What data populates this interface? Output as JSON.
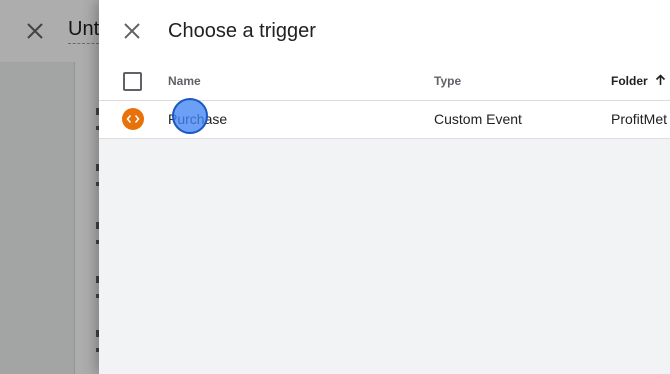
{
  "background_page": {
    "title": "Unt"
  },
  "drawer": {
    "title": "Choose a trigger",
    "columns": {
      "name": "Name",
      "type": "Type",
      "folder": "Folder"
    },
    "rows": [
      {
        "name": "Purchase",
        "type": "Custom Event",
        "folder": "ProfitMet",
        "icon": "custom-event-code-icon"
      }
    ]
  },
  "colors": {
    "trigger_icon": "#e8710a",
    "cursor_highlight": "#4285f4"
  }
}
